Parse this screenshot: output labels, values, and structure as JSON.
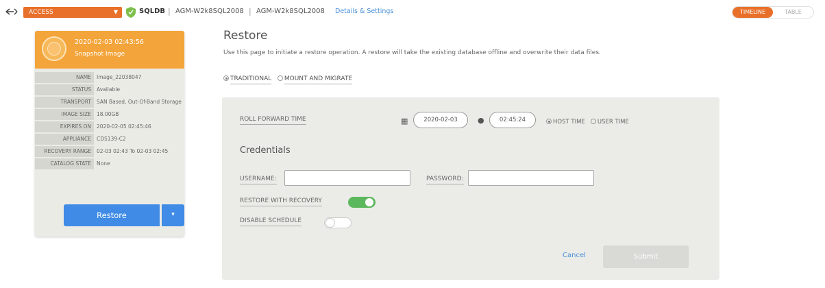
{
  "header": {
    "access_label": "ACCESS",
    "app_name": "SQLDB",
    "breadcrumb": [
      "AGM-W2k8SQL2008",
      "AGM-W2k8SQL2008"
    ],
    "details_link": "Details & Settings",
    "views": [
      "TIMELINE",
      "TABLE"
    ],
    "active_view": "TIMELINE"
  },
  "snapshot": {
    "datetime": "2020-02-03 02:43:56",
    "subtitle": "Snapshot Image",
    "fields": [
      {
        "key": "NAME",
        "value": "Image_22038047"
      },
      {
        "key": "STATUS",
        "value": "Available"
      },
      {
        "key": "TRANSPORT",
        "value": "SAN Based, Out-Of-Band Storage"
      },
      {
        "key": "IMAGE SIZE",
        "value": "18.00GB"
      },
      {
        "key": "EXPIRES ON",
        "value": "2020-02-05 02:45:46"
      },
      {
        "key": "APPLIANCE",
        "value": "CDS139-C2"
      },
      {
        "key": "RECOVERY RANGE",
        "value": "02-03 02:43 To 02-03 02:45"
      },
      {
        "key": "CATALOG STATE",
        "value": "None"
      }
    ],
    "restore_button": "Restore"
  },
  "restore": {
    "title": "Restore",
    "description": "Use this page to initiate a restore operation. A restore will take the existing database offline and overwrite their data files.",
    "modes": [
      {
        "label": "TRADITIONAL",
        "selected": true
      },
      {
        "label": "MOUNT AND MIGRATE",
        "selected": false
      }
    ],
    "roll_forward_label": "ROLL FORWARD TIME",
    "date_value": "2020-02-03",
    "time_value": "02:45:24",
    "time_modes": [
      {
        "label": "HOST TIME",
        "selected": true
      },
      {
        "label": "USER TIME",
        "selected": false
      }
    ],
    "credentials_title": "Credentials",
    "username_label": "USERNAME:",
    "password_label": "PASSWORD:",
    "restore_with_recovery_label": "RESTORE WITH RECOVERY",
    "restore_with_recovery_on": true,
    "disable_schedule_label": "DISABLE SCHEDULE",
    "disable_schedule_on": false,
    "cancel_label": "Cancel",
    "submit_label": "Submit"
  },
  "colors": {
    "accent_orange": "#e8702a",
    "card_header": "#f3a43a",
    "primary_blue": "#3f8be5",
    "toggle_on": "#5cb85c",
    "link_blue": "#4a90d9"
  }
}
